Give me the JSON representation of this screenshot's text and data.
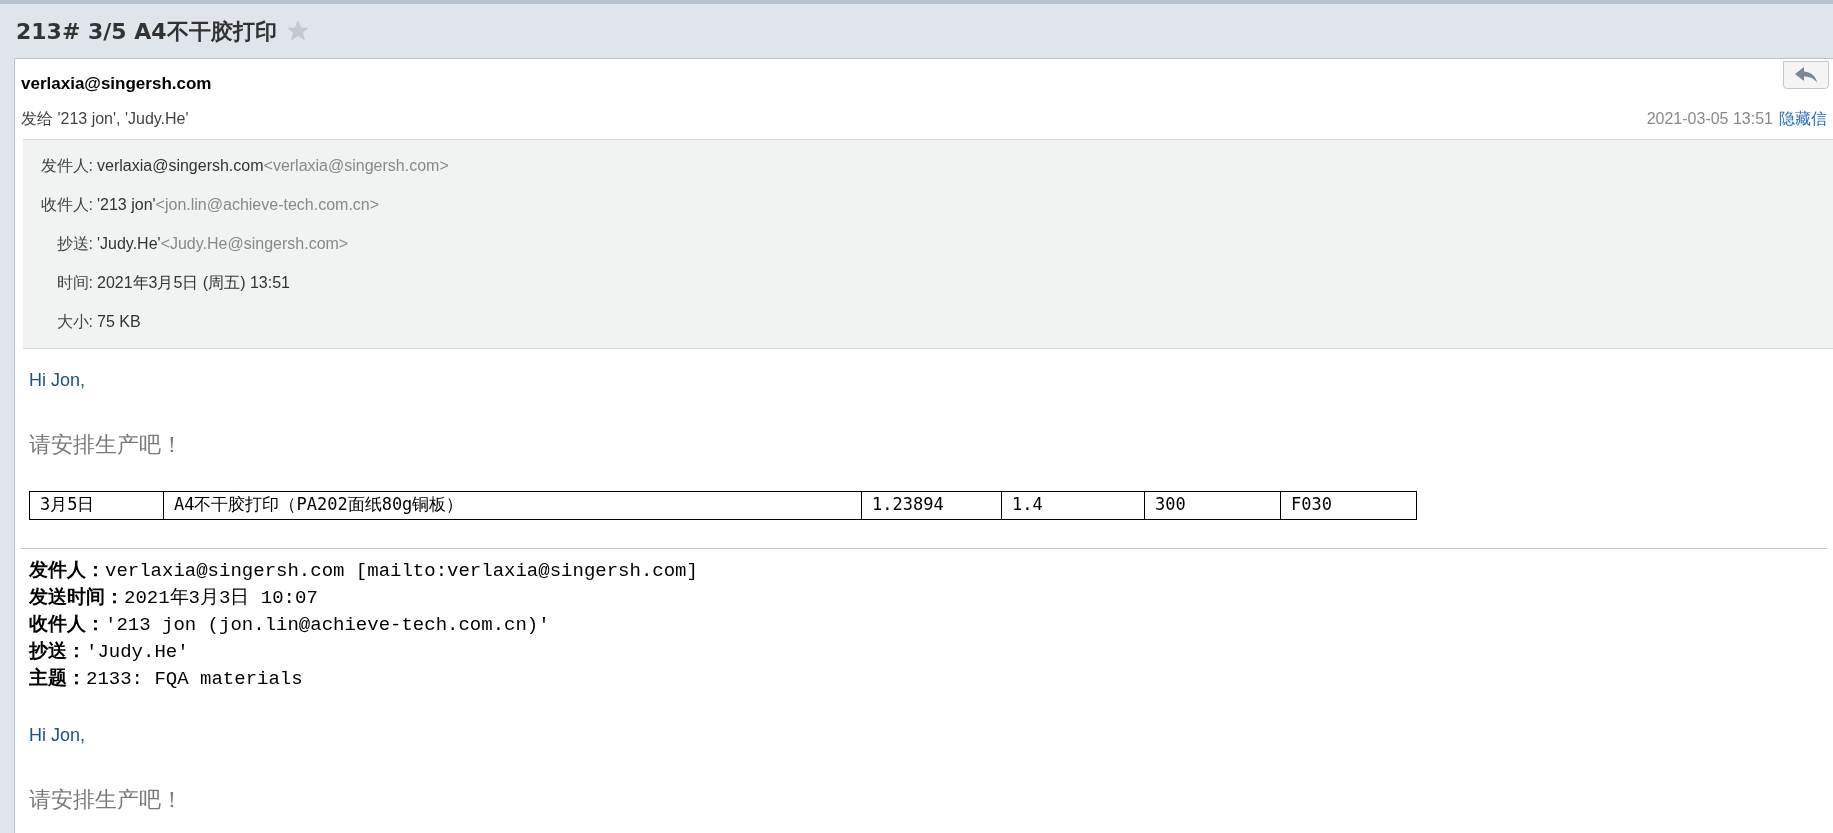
{
  "title": {
    "text": "213# 3/5 A4不干胶打印",
    "starred": false
  },
  "message": {
    "sender": "verlaxia@singersh.com",
    "to_line": "发给 '213 jon', 'Judy.He'",
    "date": "2021-03-05 13:51",
    "hide_link": "隐藏信"
  },
  "details": [
    {
      "label": "发件人:",
      "value": "verlaxia@singersh.com",
      "address": "<verlaxia@singersh.com>"
    },
    {
      "label": "收件人:",
      "value": "'213 jon'",
      "address": "<jon.lin@achieve-tech.com.cn>"
    },
    {
      "label": "抄送:",
      "value": "'Judy.He'",
      "address": "<Judy.He@singersh.com>"
    },
    {
      "label": "时间:",
      "value": "2021年3月5日 (周五) 13:51"
    },
    {
      "label": "大小:",
      "value": "75 KB"
    }
  ],
  "body": {
    "greeting": "Hi Jon,",
    "request": "请安排生产吧！",
    "table": {
      "rows": [
        [
          "3月5日",
          "A4不干胶打印（PA202面纸80g铜板）",
          "1.23894",
          "1.4",
          "300",
          "F030"
        ]
      ]
    }
  },
  "quoted": {
    "headers": [
      {
        "label": "发件人：",
        "value": "verlaxia@singersh.com [mailto:verlaxia@singersh.com]"
      },
      {
        "label": "发送时间：",
        "value": "2021年3月3日 10:07"
      },
      {
        "label": "收件人：",
        "value": "'213 jon (jon.lin@achieve-tech.com.cn)'"
      },
      {
        "label": "抄送：",
        "value": "'Judy.He'"
      },
      {
        "label": "主题：",
        "value": "2133: FQA materials"
      }
    ],
    "greeting": "Hi Jon,",
    "request": "请安排生产吧！"
  }
}
